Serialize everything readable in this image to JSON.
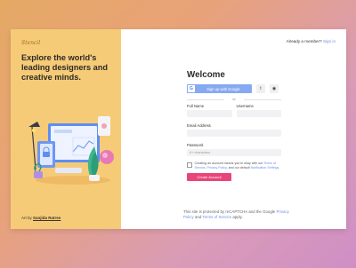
{
  "left_panel": {
    "logo": "Stencil",
    "headline": "Explore the world's leading designers and creative minds.",
    "art_by_prefix": "Art by",
    "artist": "Sanjida Ratree"
  },
  "header": {
    "member_text": "Already a member?",
    "signin_link": "Sign in"
  },
  "form": {
    "title": "Welcome",
    "google_button": "Sign up with Google",
    "twitter_icon_glyph": "t",
    "github_icon_glyph": "◉",
    "or_text": "or",
    "full_name_label": "Full Name",
    "username_label": "Username",
    "email_label": "Email Address",
    "password_label": "Password",
    "password_placeholder": "6+ characters",
    "terms_text_1": "Creating an account means you're okay with our",
    "terms_link_1": "Terms of Service",
    "terms_comma": ",",
    "terms_link_2": "Privacy Policy",
    "terms_text_2": ", and our default",
    "terms_link_3": "Notification Settings",
    "terms_period": ".",
    "create_button": "Create Account",
    "recaptcha_text": "This site is protected by reCAPTCHA and the Google",
    "privacy_link": "Privacy Policy",
    "and_text": "and",
    "tos_link": "Terms of Service",
    "apply_text": "apply."
  },
  "colors": {
    "left_panel_bg": "#f6cb78",
    "google_btn": "#86a9f2",
    "create_btn": "#e9457a",
    "link": "#6c8ff0"
  }
}
